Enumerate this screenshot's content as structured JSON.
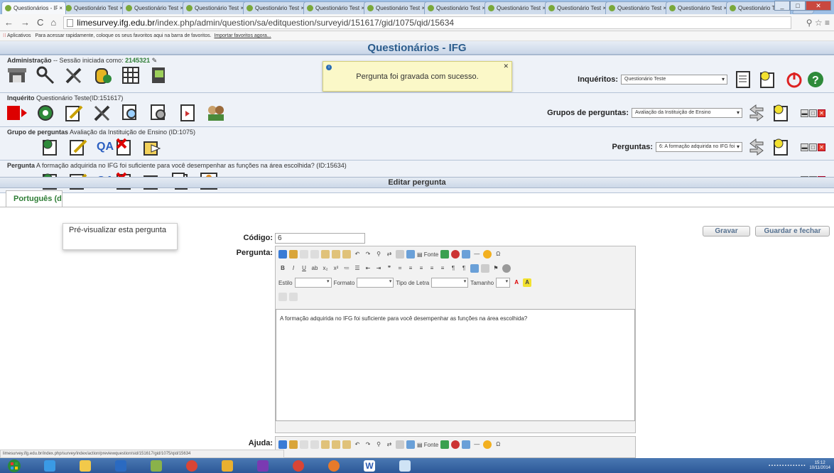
{
  "browser": {
    "tabs": [
      {
        "label": "Questionários - IFG",
        "active": true
      },
      {
        "label": "Questionário Teste",
        "active": false
      },
      {
        "label": "Questionário Teste",
        "active": false
      },
      {
        "label": "Questionário Teste",
        "active": false
      },
      {
        "label": "Questionário Teste",
        "active": false
      },
      {
        "label": "Questionário Teste",
        "active": false
      },
      {
        "label": "Questionário Teste",
        "active": false
      },
      {
        "label": "Questionário Teste",
        "active": false
      },
      {
        "label": "Questionário Teste",
        "active": false
      },
      {
        "label": "Questionário Teste",
        "active": false
      },
      {
        "label": "Questionário Teste",
        "active": false
      },
      {
        "label": "Questionário Teste",
        "active": false
      },
      {
        "label": "Questionário Teste",
        "active": false
      }
    ],
    "url_host": "limesurvey.ifg.edu.br",
    "url_path": "/index.php/admin/question/sa/editquestion/surveyid/151617/gid/1075/qid/15634",
    "bookmarks_apps": "Aplicativos",
    "bookmarks_text": "Para acessar rapidamente, coloque os seus favoritos aqui na barra de favoritos.",
    "bookmarks_link": "Importar favoritos agora..."
  },
  "page_title": "Questionários - IFG",
  "admin": {
    "label": "Administração",
    "session_text": "-- Sessão iniciada como:",
    "user": "2145321"
  },
  "notification": "Pergunta foi gravada com sucesso.",
  "inqueritos": {
    "label": "Inquéritos:",
    "selected": "Questionário Teste"
  },
  "inquerito": {
    "label": "Inquérito",
    "text": "Questionário Teste(ID:151617)"
  },
  "grupos": {
    "label": "Grupos de perguntas:",
    "selected": "Avaliação da Instituição de Ensino"
  },
  "grupo": {
    "label": "Grupo de perguntas",
    "text": "Avaliação da Instituição de Ensino (ID:1075)"
  },
  "perguntas": {
    "label": "Perguntas:",
    "selected": "6: A formação adquirida no IFG foi"
  },
  "pergunta": {
    "label": "Pergunta",
    "text": "A formação adquirida no IFG foi suficiente para você desempenhar as funções na área escolhida? (ID:15634)"
  },
  "qa_label": "QA",
  "edit_title": "Editar pergunta",
  "lang_tab": "Português (d",
  "tooltip": "Pré-visualizar esta pergunta",
  "buttons": {
    "save": "Gravar",
    "save_close": "Guardar e fechar"
  },
  "form": {
    "code_label": "Código:",
    "code_value": "6",
    "question_label": "Pergunta:",
    "question_text": "A formação adquirida no IFG foi suficiente para você desempenhar as funções na área escolhida?",
    "help_label": "Ajuda:"
  },
  "toolbar": {
    "source": "Fonte",
    "estilo": "Estilo",
    "formato": "Formato",
    "tipo_letra": "Tipo de Letra",
    "tamanho": "Tamanho"
  },
  "status_url": "limesurvey.ifg.edu.br/index.php/survey/index/action/previewquestion/sid/151617/gid/1075/qid/15634",
  "clock": {
    "time": "15:12",
    "date": "10/11/2014"
  }
}
